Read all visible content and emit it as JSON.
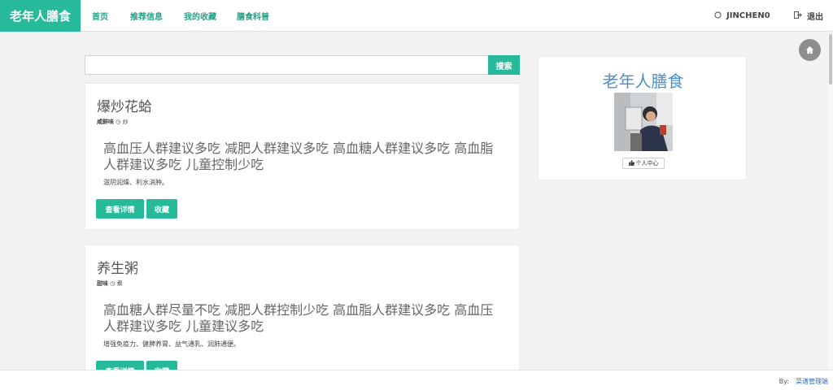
{
  "brand": "老年人膳食",
  "nav": {
    "home": "首页",
    "recommend": "推荐信息",
    "favorites": "我的收藏",
    "science": "膳食科普",
    "username": "JINCHEN0",
    "logout": "退出"
  },
  "search": {
    "value": "",
    "placeholder": "",
    "button": "搜索"
  },
  "cards": [
    {
      "title": "爆炒花蛤",
      "taste": "咸鲜味",
      "method": "炒",
      "crowd": "高血压人群建议多吃 减肥人群建议多吃 高血糖人群建议多吃 高血脂人群建议多吃 儿童控制少吃",
      "effect": "滋阴润燥、利水消肿。",
      "detail_btn": "查看详情",
      "fav_btn": "收藏"
    },
    {
      "title": "养生粥",
      "taste": "甜味",
      "method": "煮",
      "crowd": "高血糖人群尽量不吃 减肥人群控制少吃 高血脂人群建议多吃 高血压人群建议多吃 儿童建议多吃",
      "effect": "增强免疫力、健脾养胃、益气通乳、润肺通便。",
      "detail_btn": "查看详情",
      "fav_btn": "收藏"
    }
  ],
  "sidebar": {
    "title": "老年人膳食",
    "profile_btn": "个人中心"
  },
  "footer": {
    "by": "By:",
    "link": "菜谱管理端"
  },
  "colors": {
    "accent": "#26b99a",
    "link": "#2a72c2",
    "side_title": "#4a90c9"
  },
  "icons": {
    "user": "user-icon",
    "logout": "sign-out-icon",
    "clock": "clock-icon",
    "thumb": "thumbs-up-icon",
    "home": "home-icon"
  }
}
